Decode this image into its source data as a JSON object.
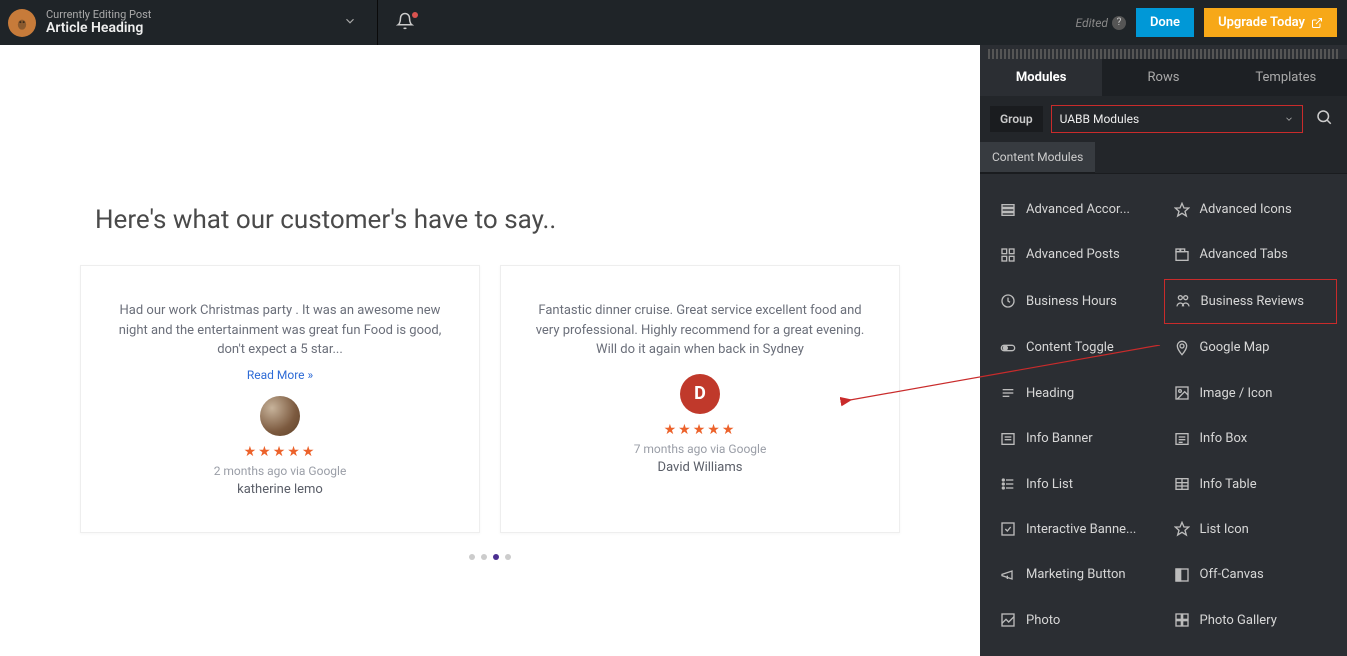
{
  "header": {
    "editing_label": "Currently Editing Post",
    "title": "Article Heading",
    "edited_label": "Edited",
    "done_label": "Done",
    "upgrade_label": "Upgrade Today"
  },
  "canvas": {
    "heading": "Here's what our customer's have to say..",
    "reviews": [
      {
        "text": "Had our work Christmas party . It was an awesome new night and the entertainment was great fun Food is good, don't expect a 5 star...",
        "read_more": "Read More »",
        "stars": "★★★★★",
        "meta": "2 months ago via Google",
        "author": "katherine lemo",
        "avatar_type": "img"
      },
      {
        "text": "Fantastic dinner cruise. Great service excellent food and very professional. Highly recommend for a great evening. Will do it again when back in Sydney",
        "read_more": "",
        "stars": "★★★★★",
        "meta": "7 months ago via Google",
        "author": "David Williams",
        "avatar_type": "letter",
        "avatar_letter": "D"
      }
    ],
    "active_dot": 2,
    "dot_count": 4
  },
  "sidebar": {
    "tabs": [
      "Modules",
      "Rows",
      "Templates"
    ],
    "active_tab": 0,
    "group_label": "Group",
    "group_value": "UABB Modules",
    "section_label": "Content Modules",
    "modules": [
      {
        "label": "Advanced Accor...",
        "icon": "accordion"
      },
      {
        "label": "Advanced Icons",
        "icon": "star"
      },
      {
        "label": "Advanced Posts",
        "icon": "posts"
      },
      {
        "label": "Advanced Tabs",
        "icon": "tabs"
      },
      {
        "label": "Business Hours",
        "icon": "clock"
      },
      {
        "label": "Business Reviews",
        "icon": "reviews",
        "highlight": true
      },
      {
        "label": "Content Toggle",
        "icon": "toggle"
      },
      {
        "label": "Google Map",
        "icon": "pin"
      },
      {
        "label": "Heading",
        "icon": "heading"
      },
      {
        "label": "Image / Icon",
        "icon": "image"
      },
      {
        "label": "Info Banner",
        "icon": "banner"
      },
      {
        "label": "Info Box",
        "icon": "list"
      },
      {
        "label": "Info List",
        "icon": "checklist"
      },
      {
        "label": "Info Table",
        "icon": "table"
      },
      {
        "label": "Interactive Banne...",
        "icon": "interactive"
      },
      {
        "label": "List Icon",
        "icon": "star"
      },
      {
        "label": "Marketing Button",
        "icon": "megaphone"
      },
      {
        "label": "Off-Canvas",
        "icon": "offcanvas"
      },
      {
        "label": "Photo",
        "icon": "photo"
      },
      {
        "label": "Photo Gallery",
        "icon": "gallery"
      }
    ]
  }
}
